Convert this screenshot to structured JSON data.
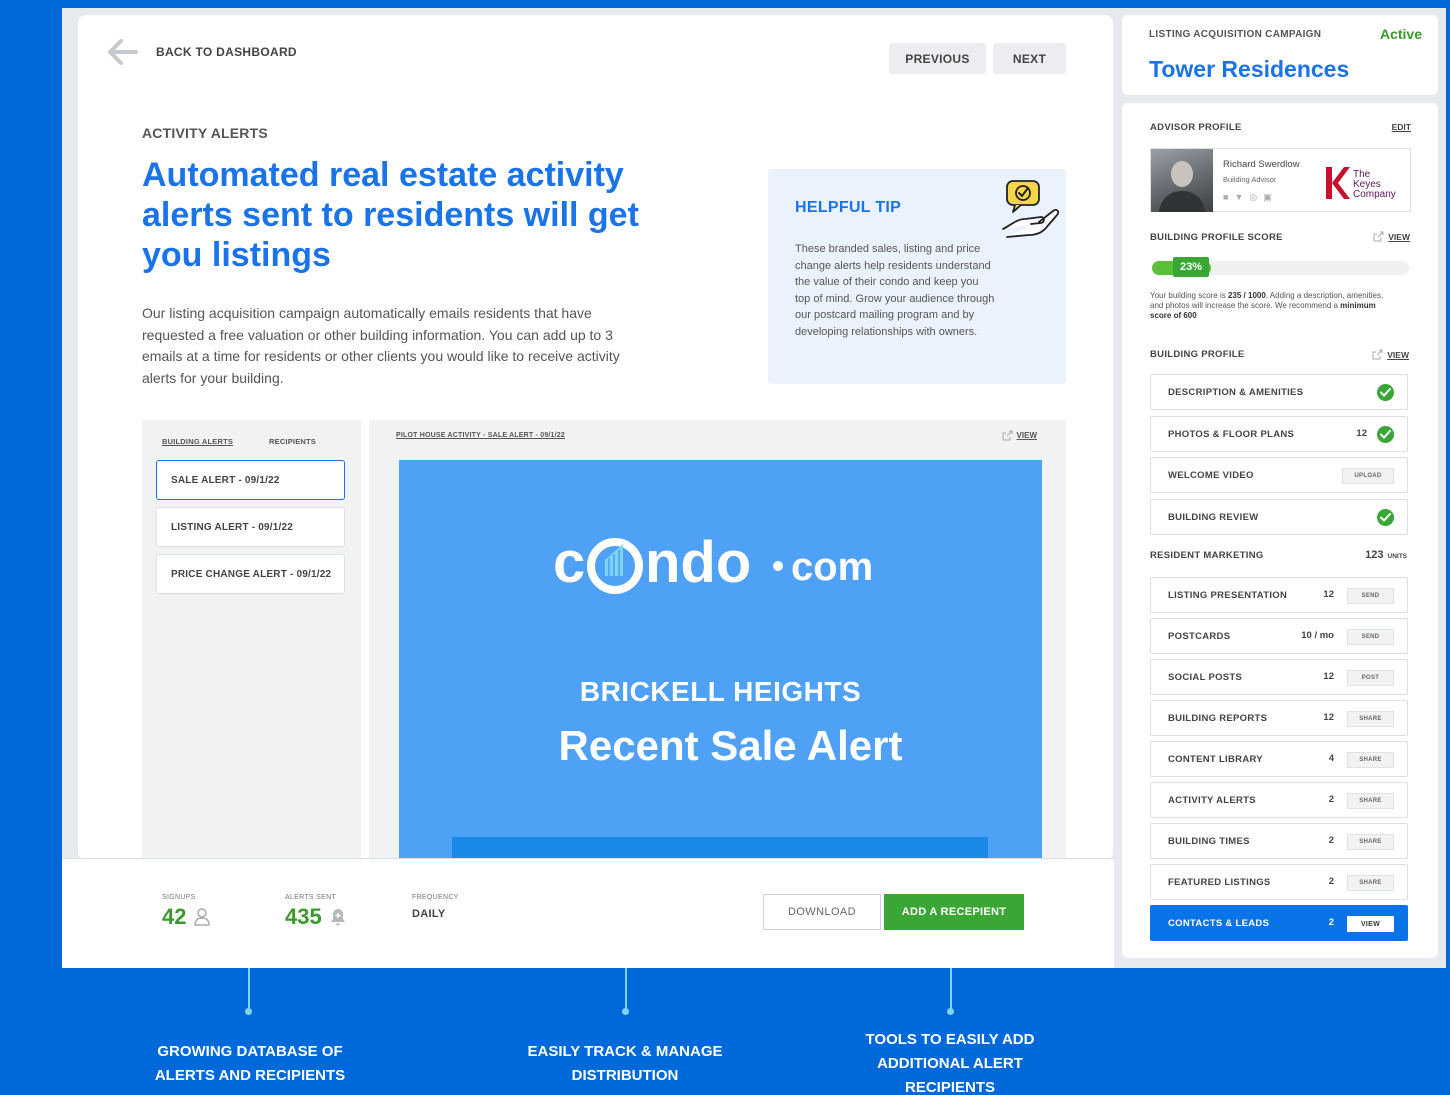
{
  "nav": {
    "back_label": "BACK TO DASHBOARD",
    "previous_label": "PREVIOUS",
    "next_label": "NEXT"
  },
  "content": {
    "section_label": "ACTIVITY ALERTS",
    "headline": "Automated real estate activity alerts sent to residents will get you listings",
    "intro": "Our listing acquisition campaign automatically emails residents that have requested a free valuation or other building information. You can add up to 3 emails at a time for residents or other clients you would like to receive activity alerts for your building."
  },
  "tip": {
    "title": "HELPFUL TIP",
    "body": "These branded sales, listing and price change alerts help residents understand the value of their condo and keep you top of mind. Grow your audience through our postcard mailing program and by developing relationships with owners."
  },
  "alerts_list": {
    "tabs": [
      "BUILDING ALERTS",
      "RECIPIENTS"
    ],
    "items": [
      "SALE ALERT - 09/1/22",
      "LISTING ALERT - 09/1/22",
      "PRICE CHANGE ALERT - 09/1/22"
    ]
  },
  "preview": {
    "title": "PILOT HOUSE ACTIVITY - SALE ALERT - 09/1/22",
    "view_label": "VIEW",
    "logo_text_left": "c",
    "logo_text_right": "ndo",
    "logo_suffix": "com",
    "subtitle": "BRICKELL HEIGHTS",
    "title_text": "Recent Sale Alert"
  },
  "stats": {
    "signups_label": "SIGNUPS",
    "signups_value": "42",
    "alerts_label": "ALERTS SENT",
    "alerts_value": "435",
    "frequency_label": "FREQUENCY",
    "frequency_value": "DAILY",
    "download_label": "DOWNLOAD",
    "add_label": "ADD A RECEPIENT"
  },
  "campaign": {
    "label": "LISTING ACQUISITION CAMPAIGN",
    "status": "Active",
    "name": "Tower Residences"
  },
  "advisor": {
    "section_label": "ADVISOR PROFILE",
    "edit_label": "EDIT",
    "name": "Richard Swerdlow",
    "role": "Building Advisor",
    "company_line1": "The",
    "company_line2": "Keyes",
    "company_line3": "Company"
  },
  "score": {
    "label": "BUILDING PROFILE SCORE",
    "view_label": "VIEW",
    "percent": 23,
    "percent_text": "23%",
    "text_prefix": "Your building score is ",
    "text_score": "235 / 1000",
    "text_middle": ". Adding a description, amenities, and photos will increase the score. We recommend a ",
    "text_min": "minimum score of 600"
  },
  "building_profile": {
    "label": "BUILDING PROFILE",
    "view_label": "VIEW",
    "rows": [
      {
        "label": "DESCRIPTION & AMENITIES",
        "count": "",
        "action": "check"
      },
      {
        "label": "PHOTOS & FLOOR PLANS",
        "count": "12",
        "action": "check"
      },
      {
        "label": "WELCOME VIDEO",
        "count": "",
        "action": "UPLOAD"
      },
      {
        "label": "BUILDING REVIEW",
        "count": "",
        "action": "check"
      }
    ]
  },
  "resident_marketing": {
    "label": "RESIDENT MARKETING",
    "units_value": "123",
    "units_label": "UNITS",
    "rows": [
      {
        "label": "LISTING PRESENTATION",
        "count": "12",
        "action": "SEND"
      },
      {
        "label": "POSTCARDS",
        "count": "10 / mo",
        "action": "SEND"
      },
      {
        "label": "SOCIAL POSTS",
        "count": "12",
        "action": "POST"
      },
      {
        "label": "BUILDING REPORTS",
        "count": "12",
        "action": "SHARE"
      },
      {
        "label": "CONTENT LIBRARY",
        "count": "4",
        "action": "SHARE"
      },
      {
        "label": "ACTIVITY ALERTS",
        "count": "2",
        "action": "SHARE"
      },
      {
        "label": "BUILDING TIMES",
        "count": "2",
        "action": "SHARE"
      },
      {
        "label": "FEATURED LISTINGS",
        "count": "2",
        "action": "SHARE"
      },
      {
        "label": "CONTACTS & LEADS",
        "count": "2",
        "action": "VIEW"
      }
    ]
  },
  "callouts": [
    "GROWING DATABASE OF ALERTS AND RECIPIENTS",
    "EASILY TRACK & MANAGE DISTRIBUTION",
    "TOOLS TO EASILY ADD ADDITIONAL ALERT RECIPIENTS"
  ],
  "colors": {
    "brand_blue": "#1a73e8",
    "background_blue": "#0069d9",
    "accent_green": "#3aa635",
    "email_blue": "#4ea1f5"
  }
}
